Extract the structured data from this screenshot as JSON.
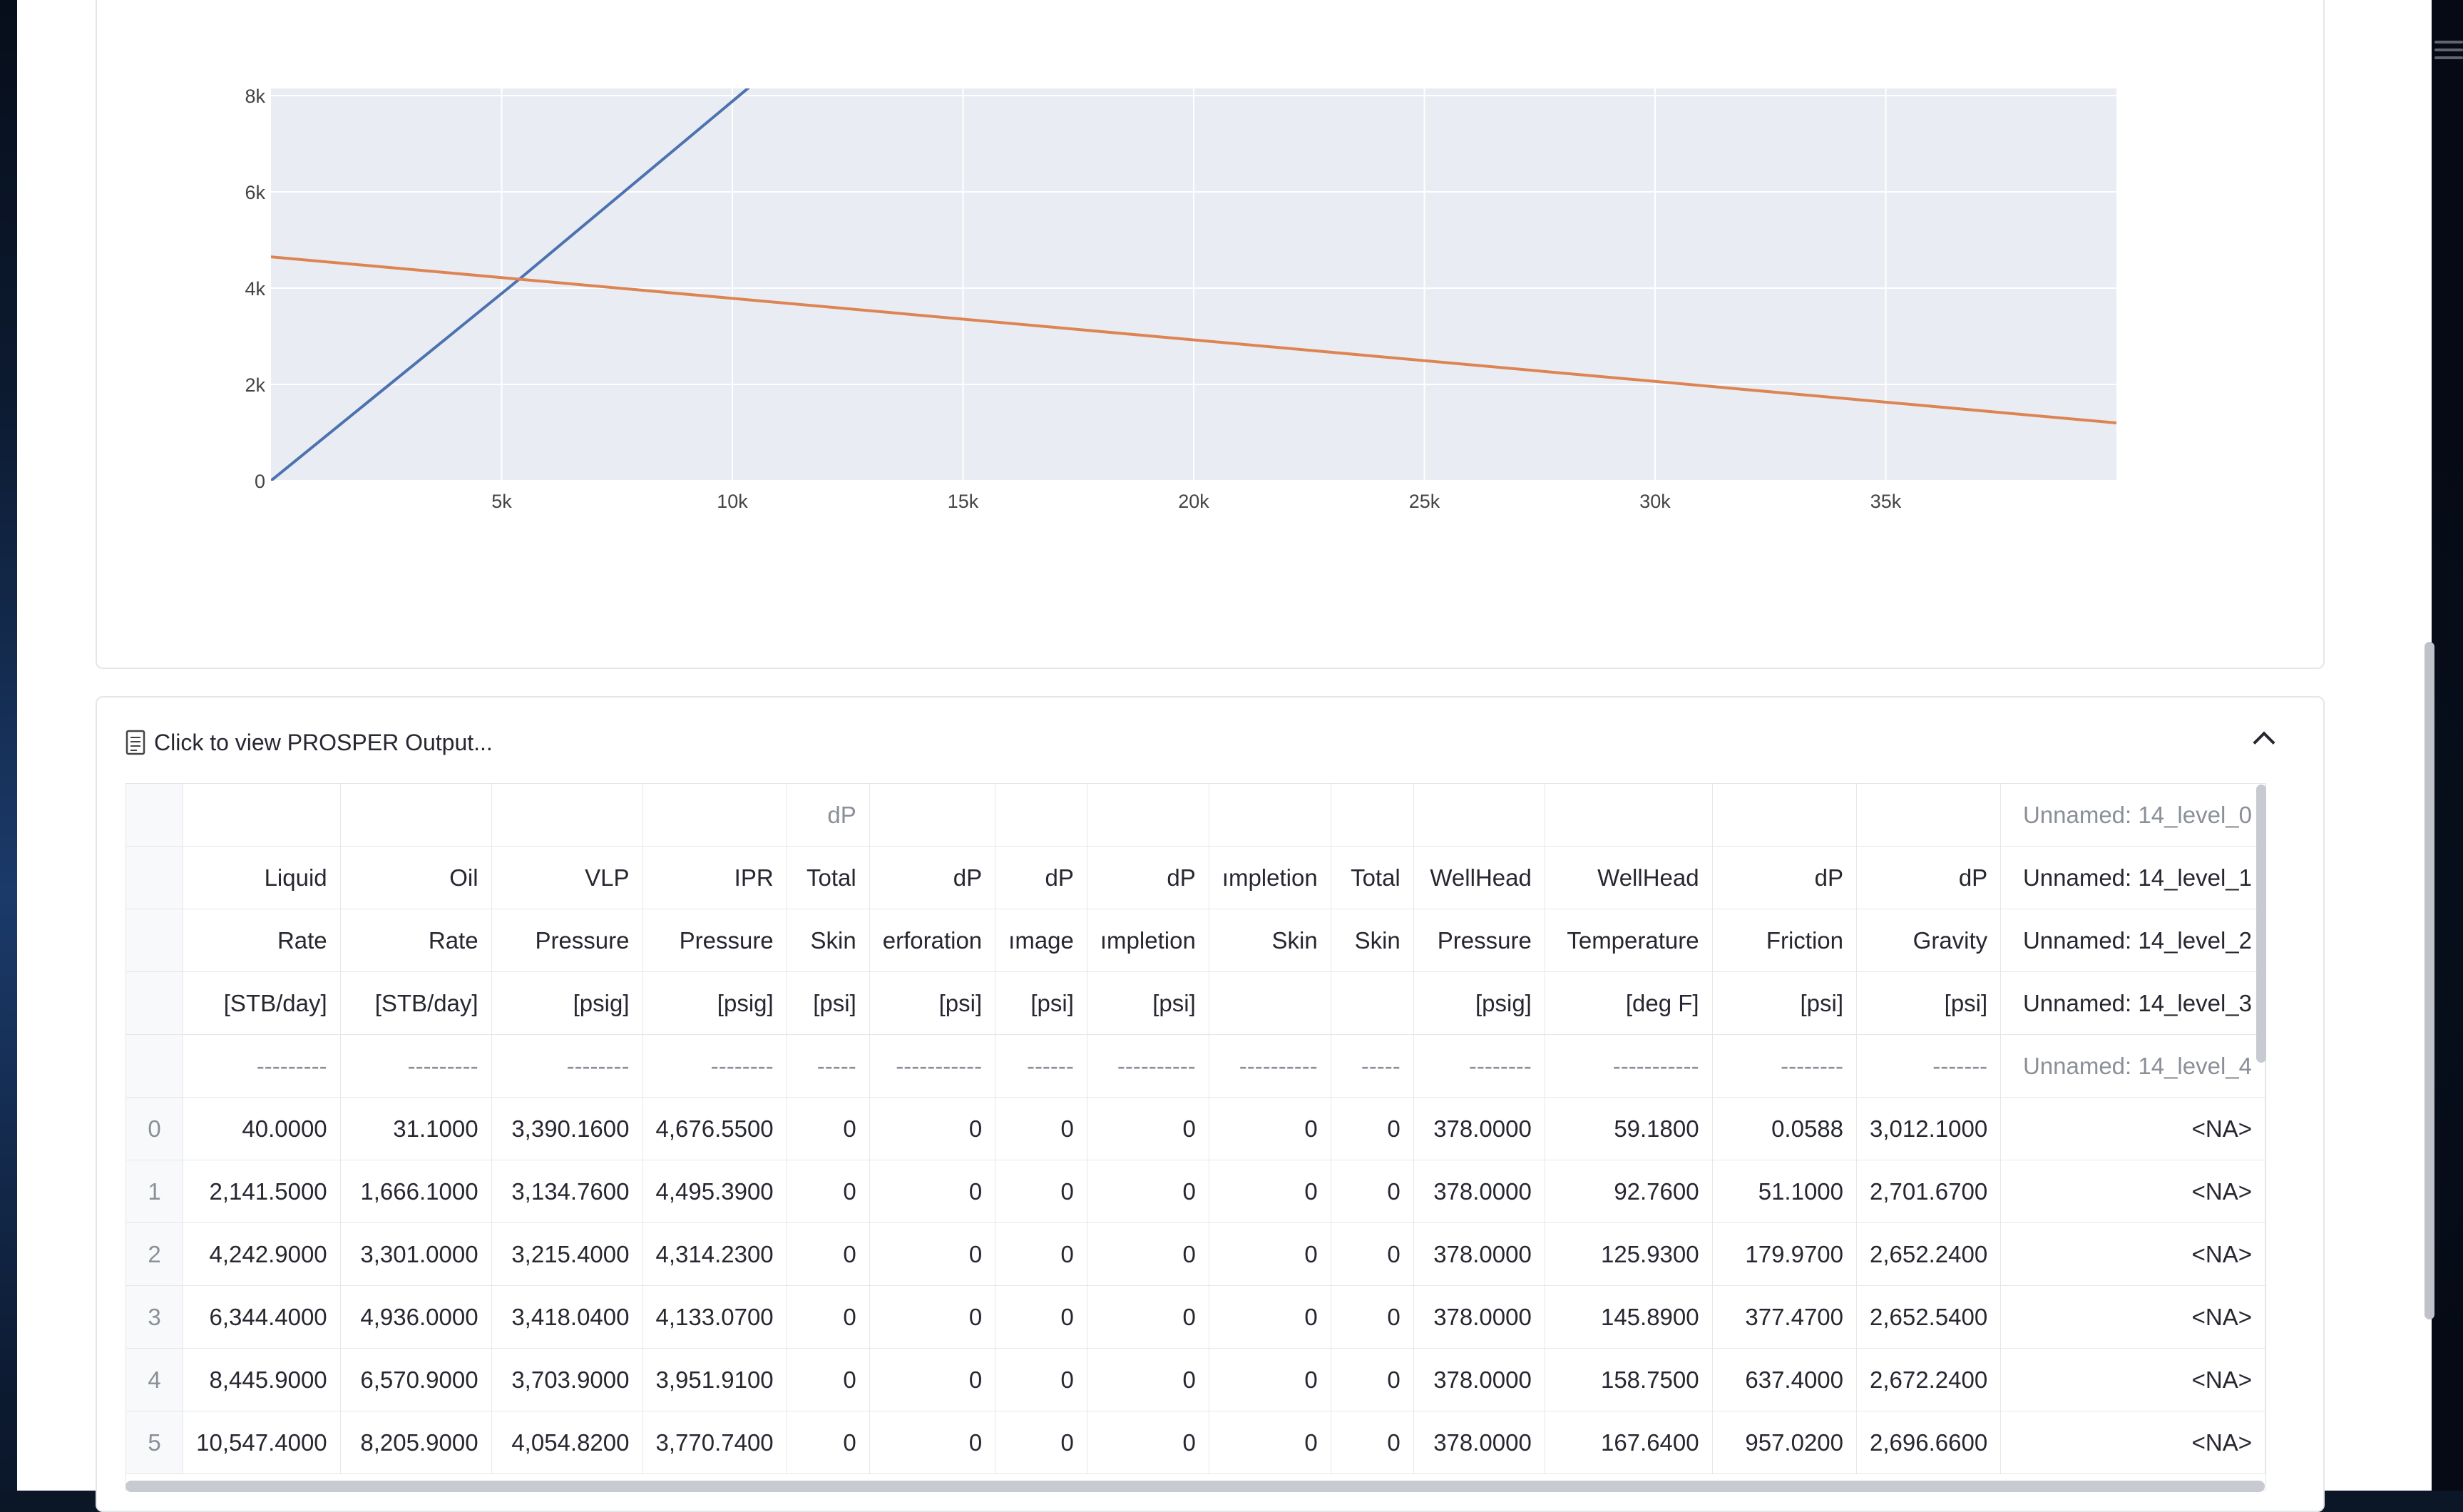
{
  "chart_data": {
    "type": "line",
    "xlim": [
      0,
      40000
    ],
    "ylim": [
      0,
      8000
    ],
    "x_ticks": [
      "5k",
      "10k",
      "15k",
      "20k",
      "25k",
      "30k",
      "35k"
    ],
    "x_tick_values": [
      5000,
      10000,
      15000,
      20000,
      25000,
      30000,
      35000
    ],
    "y_ticks": [
      "0",
      "2k",
      "4k",
      "6k",
      "8k"
    ],
    "y_tick_values": [
      0,
      2000,
      4000,
      6000,
      8000
    ],
    "grid": true,
    "series": [
      {
        "color": "#4c72b0",
        "x": [
          0,
          5400,
          10400
        ],
        "y": [
          0,
          4200,
          8200
        ]
      },
      {
        "color": "#dd8452",
        "x": [
          0,
          40000
        ],
        "y": [
          4650,
          1200
        ]
      }
    ]
  },
  "expander": {
    "title": "Click to view PROSPER Output..."
  },
  "table": {
    "header_rows": [
      [
        "",
        "",
        "",
        "",
        "dP",
        "",
        "",
        "",
        "",
        "",
        "",
        "",
        "",
        "",
        "Unnamed: 14_level_0"
      ],
      [
        "Liquid",
        "Oil",
        "VLP",
        "IPR",
        "Total",
        "dP",
        "dP",
        "dP",
        "ımpletion",
        "Total",
        "WellHead",
        "WellHead",
        "dP",
        "dP",
        "Unnamed: 14_level_1"
      ],
      [
        "Rate",
        "Rate",
        "Pressure",
        "Pressure",
        "Skin",
        "erforation",
        "ımage",
        "ımpletion",
        "Skin",
        "Skin",
        "Pressure",
        "Temperature",
        "Friction",
        "Gravity",
        "Unnamed: 14_level_2"
      ],
      [
        "[STB/day]",
        "[STB/day]",
        "[psig]",
        "[psig]",
        "[psi]",
        "[psi]",
        "[psi]",
        "[psi]",
        "",
        "",
        "[psig]",
        "[deg F]",
        "[psi]",
        "[psi]",
        "Unnamed: 14_level_3"
      ],
      [
        "---------",
        "---------",
        "--------",
        "--------",
        "-----",
        "-----------",
        "------",
        "----------",
        "----------",
        "-----",
        "--------",
        "-----------",
        "--------",
        "-------",
        "Unnamed: 14_level_4"
      ]
    ],
    "rows": [
      {
        "index": "0",
        "cells": [
          "40.0000",
          "31.1000",
          "3,390.1600",
          "4,676.5500",
          "0",
          "0",
          "0",
          "0",
          "0",
          "0",
          "378.0000",
          "59.1800",
          "0.0588",
          "3,012.1000",
          "<NA>"
        ]
      },
      {
        "index": "1",
        "cells": [
          "2,141.5000",
          "1,666.1000",
          "3,134.7600",
          "4,495.3900",
          "0",
          "0",
          "0",
          "0",
          "0",
          "0",
          "378.0000",
          "92.7600",
          "51.1000",
          "2,701.6700",
          "<NA>"
        ]
      },
      {
        "index": "2",
        "cells": [
          "4,242.9000",
          "3,301.0000",
          "3,215.4000",
          "4,314.2300",
          "0",
          "0",
          "0",
          "0",
          "0",
          "0",
          "378.0000",
          "125.9300",
          "179.9700",
          "2,652.2400",
          "<NA>"
        ]
      },
      {
        "index": "3",
        "cells": [
          "6,344.4000",
          "4,936.0000",
          "3,418.0400",
          "4,133.0700",
          "0",
          "0",
          "0",
          "0",
          "0",
          "0",
          "378.0000",
          "145.8900",
          "377.4700",
          "2,652.5400",
          "<NA>"
        ]
      },
      {
        "index": "4",
        "cells": [
          "8,445.9000",
          "6,570.9000",
          "3,703.9000",
          "3,951.9100",
          "0",
          "0",
          "0",
          "0",
          "0",
          "0",
          "378.0000",
          "158.7500",
          "637.4000",
          "2,672.2400",
          "<NA>"
        ]
      },
      {
        "index": "5",
        "cells": [
          "10,547.4000",
          "8,205.9000",
          "4,054.8200",
          "3,770.7400",
          "0",
          "0",
          "0",
          "0",
          "0",
          "0",
          "378.0000",
          "167.6400",
          "957.0200",
          "2,696.6600",
          "<NA>"
        ]
      }
    ]
  }
}
